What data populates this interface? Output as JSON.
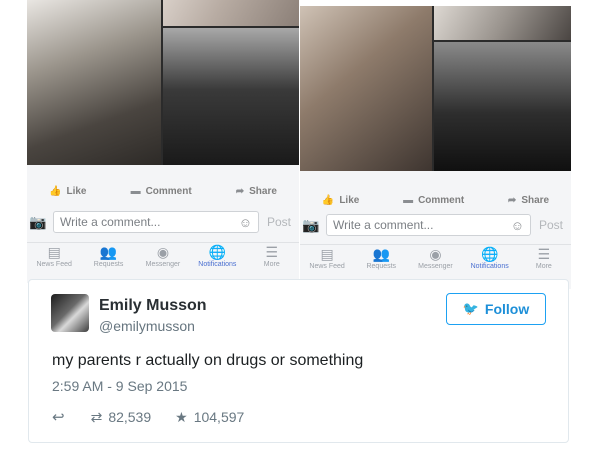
{
  "screens": [
    {
      "actions": {
        "like": "Like",
        "comment": "Comment",
        "share": "Share"
      },
      "composer": {
        "placeholder": "Write a comment...",
        "post": "Post"
      },
      "nav": [
        "News Feed",
        "Requests",
        "Messenger",
        "Notifications",
        "More"
      ]
    },
    {
      "actions": {
        "like": "Like",
        "comment": "Comment",
        "share": "Share"
      },
      "composer": {
        "placeholder": "Write a comment...",
        "post": "Post"
      },
      "nav": [
        "News Feed",
        "Requests",
        "Messenger",
        "Notifications",
        "More"
      ]
    }
  ],
  "icons": {
    "like": "thumbs-up-icon",
    "comment": "speech-bubble-icon",
    "share": "arrow-share-icon",
    "camera": "camera-icon",
    "smiley": "smiley-icon",
    "nav": [
      "news-feed-icon",
      "friend-requests-icon",
      "messenger-icon",
      "globe-icon",
      "menu-icon"
    ],
    "reply": "reply-icon",
    "retweet": "retweet-icon",
    "like_star": "star-icon",
    "bird": "twitter-bird-icon"
  },
  "tweet": {
    "display_name": "Emily Musson",
    "handle": "@emilymusson",
    "follow": "Follow",
    "text": "my parents r actually on drugs or something",
    "timestamp": "2:59 AM - 9 Sep 2015",
    "retweets": "82,539",
    "likes": "104,597"
  },
  "colors": {
    "twitter_blue": "#1da1f2",
    "fb_active": "#4a6fd0"
  }
}
